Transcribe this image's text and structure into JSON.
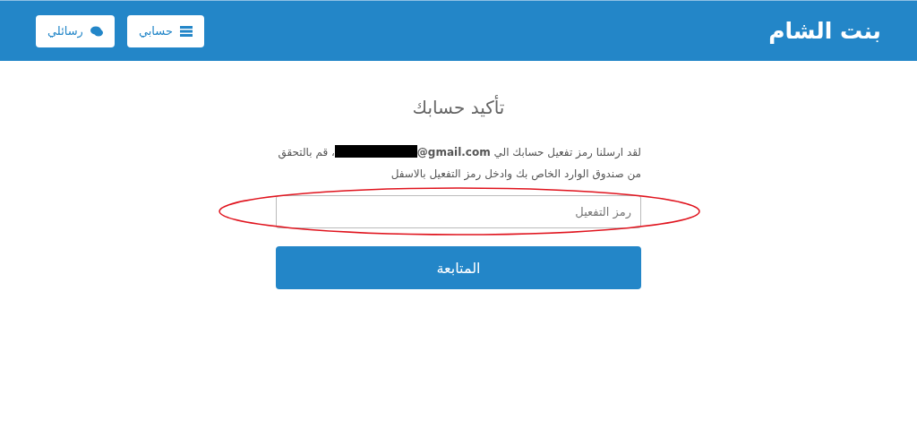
{
  "header": {
    "brand": "بنت الشام",
    "buttons": [
      {
        "label": "حسابي",
        "kind": "list"
      },
      {
        "label": "رسائلي",
        "kind": "chat"
      }
    ]
  },
  "main": {
    "title": "تأكيد حسابك",
    "message": {
      "before": "لقد ارسلنا رمز تفعيل حسابك الي ",
      "email": "@gmail.com",
      "after": "، قم بالتحقق من صندوق الوارد الخاص بك وادخل رمز التفعيل بالاسفل"
    },
    "code_field": {
      "placeholder": "رمز التفعيل",
      "annotation": {
        "kind": "ellipse"
      }
    },
    "submit": "المتابعة"
  }
}
